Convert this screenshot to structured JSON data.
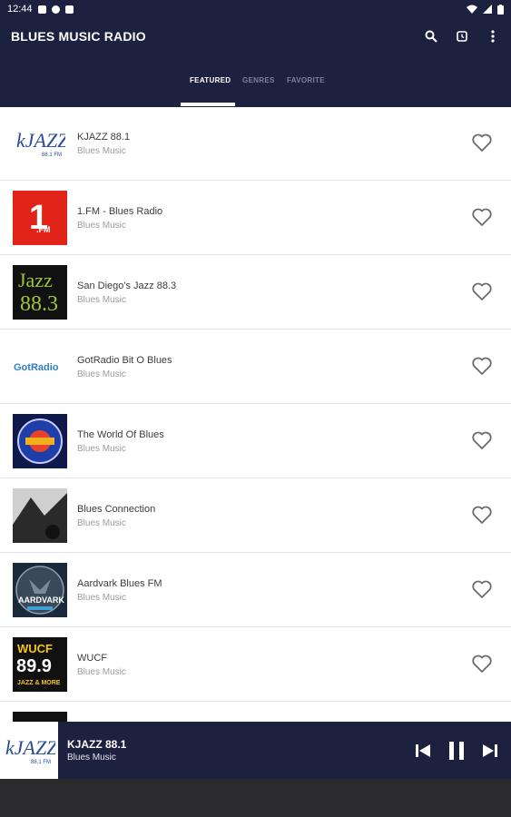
{
  "status_bar": {
    "time": "12:44"
  },
  "app": {
    "title": "BLUES MUSIC RADIO"
  },
  "tabs": [
    {
      "label": "FEATURED",
      "active": true
    },
    {
      "label": "GENRES",
      "active": false
    },
    {
      "label": "FAVORITE",
      "active": false
    }
  ],
  "stations": [
    {
      "name": "KJAZZ 88.1",
      "genre": "Blues Music",
      "logo": "kjazz-logo"
    },
    {
      "name": "1.FM - Blues Radio",
      "genre": "Blues Music",
      "logo": "onefm-logo"
    },
    {
      "name": "San Diego's Jazz 88.3",
      "genre": "Blues Music",
      "logo": "jazz883-logo"
    },
    {
      "name": "GotRadio Bit O Blues",
      "genre": "Blues Music",
      "logo": "gotradio-logo"
    },
    {
      "name": "The World Of Blues",
      "genre": "Blues Music",
      "logo": "world-of-blues-logo"
    },
    {
      "name": "Blues Connection",
      "genre": "Blues Music",
      "logo": "blues-connection-logo"
    },
    {
      "name": "Aardvark Blues FM",
      "genre": "Blues Music",
      "logo": "aardvark-logo"
    },
    {
      "name": "WUCF",
      "genre": "Blues Music",
      "logo": "wucf-logo"
    }
  ],
  "player": {
    "station": "KJAZZ 88.1",
    "genre": "Blues Music"
  },
  "logo_text": {
    "kjazz": "kJAZZ",
    "kjazz_sub": "88.1 FM",
    "onefm": "1",
    "onefm_sub": ".FM",
    "jazz_top": "Jazz",
    "jazz_num": "88.3",
    "gotradio": "GotRadio",
    "aardvark": "AARDVARK",
    "wucf_top": "WUCF",
    "wucf_num": "89.9",
    "wucf_bottom": "JAZZ & MORE"
  },
  "colors": {
    "primary": "#1c2140",
    "list_bg": "#ffffff",
    "onefm_red": "#e2231a",
    "jazz_green": "#9ec43a",
    "wucf_yellow": "#f5c518"
  }
}
